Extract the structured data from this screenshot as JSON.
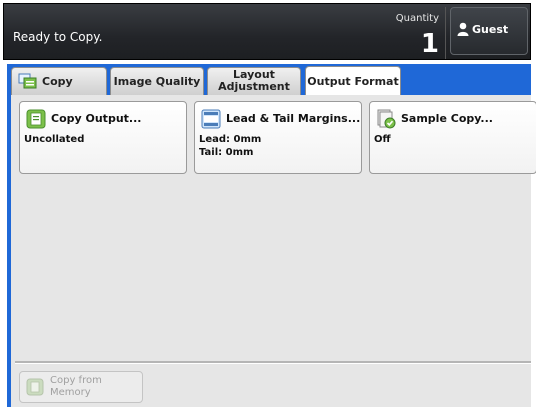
{
  "status_bar": {
    "message": "Ready to Copy.",
    "quantity_label": "Quantity",
    "quantity_value": "1",
    "user_label": "Guest"
  },
  "tabs": [
    {
      "label": "Copy",
      "active": false
    },
    {
      "label": "Image Quality",
      "active": false
    },
    {
      "label": "Layout Adjustment",
      "active": false
    },
    {
      "label": "Output Format",
      "active": true
    }
  ],
  "features": [
    {
      "title": "Copy Output...",
      "values": [
        "Uncollated"
      ],
      "icon": "copy-output-icon"
    },
    {
      "title": "Lead & Tail Margins...",
      "values": [
        "Lead: 0mm",
        "Tail: 0mm"
      ],
      "icon": "margins-icon"
    },
    {
      "title": "Sample Copy...",
      "values": [
        "Off"
      ],
      "icon": "sample-copy-icon"
    }
  ],
  "footer": {
    "memory_button_label": "Copy from Memory"
  },
  "colors": {
    "tab_strip_blue": "#1f68d7",
    "status_bar_dark": "#232529",
    "panel_gray": "#e6e6e6",
    "icon_green": "#7cc04a"
  }
}
